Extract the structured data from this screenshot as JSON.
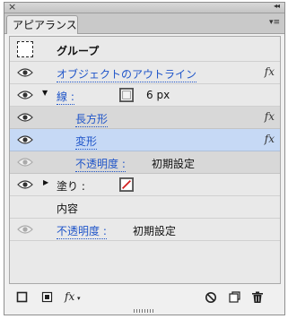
{
  "panel": {
    "close_glyph": "×",
    "collapse_glyph": "◂◂",
    "tab_label": "アピアランス",
    "menu_glyph": "▾≡"
  },
  "rows": {
    "group": {
      "label": "グループ"
    },
    "outline": {
      "label": "オブジェクトのアウトライン",
      "fx": "fx"
    },
    "stroke": {
      "label": "線 :",
      "weight": "6 px"
    },
    "rectangle": {
      "label": "長方形",
      "fx": "fx"
    },
    "transform": {
      "label": "変形",
      "fx": "fx"
    },
    "stroke_opacity": {
      "label": "不透明度 :",
      "value": "初期設定"
    },
    "fill": {
      "label": "塗り :"
    },
    "content": {
      "label": "内容"
    },
    "opacity": {
      "label": "不透明度 :",
      "value": "初期設定"
    }
  },
  "footer": {
    "fx_label": "fx"
  },
  "colors": {
    "link": "#1f55c9",
    "selected_row": "#c6d9f5",
    "indented_row": "#d8d8d8",
    "list_bg": "#e9e9e9"
  },
  "icons": [
    "eye-icon",
    "disclosure-triangle-icon",
    "stroke-swatch-icon",
    "fill-none-swatch-icon",
    "new-stroke-icon",
    "new-fill-icon",
    "fx-menu-icon",
    "clear-appearance-icon",
    "duplicate-item-icon",
    "trash-icon"
  ]
}
